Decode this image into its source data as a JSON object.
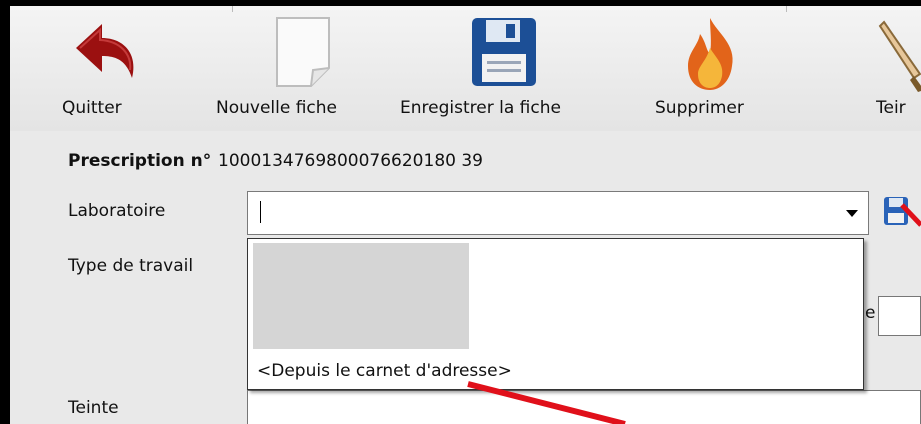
{
  "toolbar": {
    "quit_label": "Quitter",
    "new_label": "Nouvelle fiche",
    "save_label": "Enregistrer la fiche",
    "delete_label": "Supprimer",
    "shade_label": "Teir"
  },
  "form": {
    "prescription_label": "Prescription n°",
    "prescription_number": "1000134769800076620180 39",
    "laboratoire_label": "Laboratoire",
    "laboratoire_value": "",
    "type_travail_label": "Type de travail",
    "partial_label": "e",
    "teinte_label": "Teinte"
  },
  "dropdown": {
    "items": [
      "<Depuis le carnet d'adresse>"
    ]
  },
  "icons": {
    "quit": "undo-arrow-icon",
    "new": "blank-page-icon",
    "save": "floppy-disk-icon",
    "delete": "flame-icon",
    "shade": "brush-icon",
    "lab_button": "floppy-small-icon"
  },
  "colors": {
    "annotation": "#e0101a",
    "quit_icon": "#9b1010",
    "save_icon": "#1c4f96"
  }
}
